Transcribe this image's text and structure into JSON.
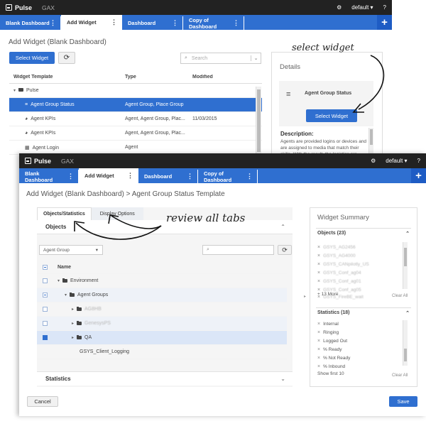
{
  "app": {
    "brand": "Pulse",
    "secondary": "GAX",
    "user": "default",
    "help": "?"
  },
  "tabs": [
    {
      "label": "Blank Dashboard"
    },
    {
      "label": "Add Widget"
    },
    {
      "label": "Dashboard"
    },
    {
      "label": "Copy of Dashboard"
    }
  ],
  "back": {
    "title": "Add Widget (Blank Dashboard)",
    "select_button": "Select Widget",
    "search_placeholder": "Search",
    "columns": [
      "Widget Template",
      "Type",
      "Modified"
    ],
    "rows": [
      {
        "name": "Pulse",
        "type": "",
        "modified": ""
      },
      {
        "name": "Agent Group Status",
        "type": "Agent Group, Place Group",
        "modified": ""
      },
      {
        "name": "Agent KPIs",
        "type": "Agent, Agent Group, Plac...",
        "modified": "11/03/2015"
      },
      {
        "name": "Agent KPIs",
        "type": "Agent, Agent Group, Plac...",
        "modified": ""
      },
      {
        "name": "Agent Login",
        "type": "Agent",
        "modified": ""
      }
    ],
    "details": {
      "heading": "Details",
      "widget_name": "Agent Group Status",
      "select_button": "Select Widget",
      "description_label": "Description:",
      "description_text": "Agents are provided logins or devices and are assigned to media that match their skills. With the result, the logistics are..."
    }
  },
  "front": {
    "title": "Add Widget (Blank Dashboard) > Agent Group Status Template",
    "subtabs": [
      "Objects/Statistics",
      "Display Options"
    ],
    "objects_label": "Objects",
    "object_type": "Agent Group",
    "name_col": "Name",
    "tree": [
      {
        "label": "Environment",
        "level": 0
      },
      {
        "label": "Agent Groups",
        "level": 1
      },
      {
        "label": "AG8HB",
        "level": 2
      },
      {
        "label": "GenesysPS",
        "level": 2
      },
      {
        "label": "QA",
        "level": 2
      },
      {
        "label": "GSYS_Client_Logging",
        "level": 2
      }
    ],
    "statistics_label": "Statistics",
    "cancel": "Cancel",
    "save": "Save",
    "summary": {
      "heading": "Widget Summary",
      "objects_header": "Objects (23)",
      "objects": [
        "GSYS_AG2456",
        "GSYS_AG4000",
        "GSYS_CANpilotly_US",
        "GSYS_Conf_ag04",
        "GSYS_Conf_ag01",
        "GSYS_Conf_ag05",
        "GSYS_FireBE_wait"
      ],
      "objects_more": "+ 13 More",
      "clear_all": "Clear All",
      "stats_header": "Statistics (18)",
      "stats": [
        "Internal",
        "Ringing",
        "Logged Out",
        "% Ready",
        "% Not Ready",
        "% Inbound"
      ],
      "show_first": "Show first 10"
    }
  },
  "annotations": {
    "select": "select widget",
    "review": "review all tabs"
  },
  "colors": {
    "primary": "#2f6fd0",
    "topbar": "#222222"
  }
}
